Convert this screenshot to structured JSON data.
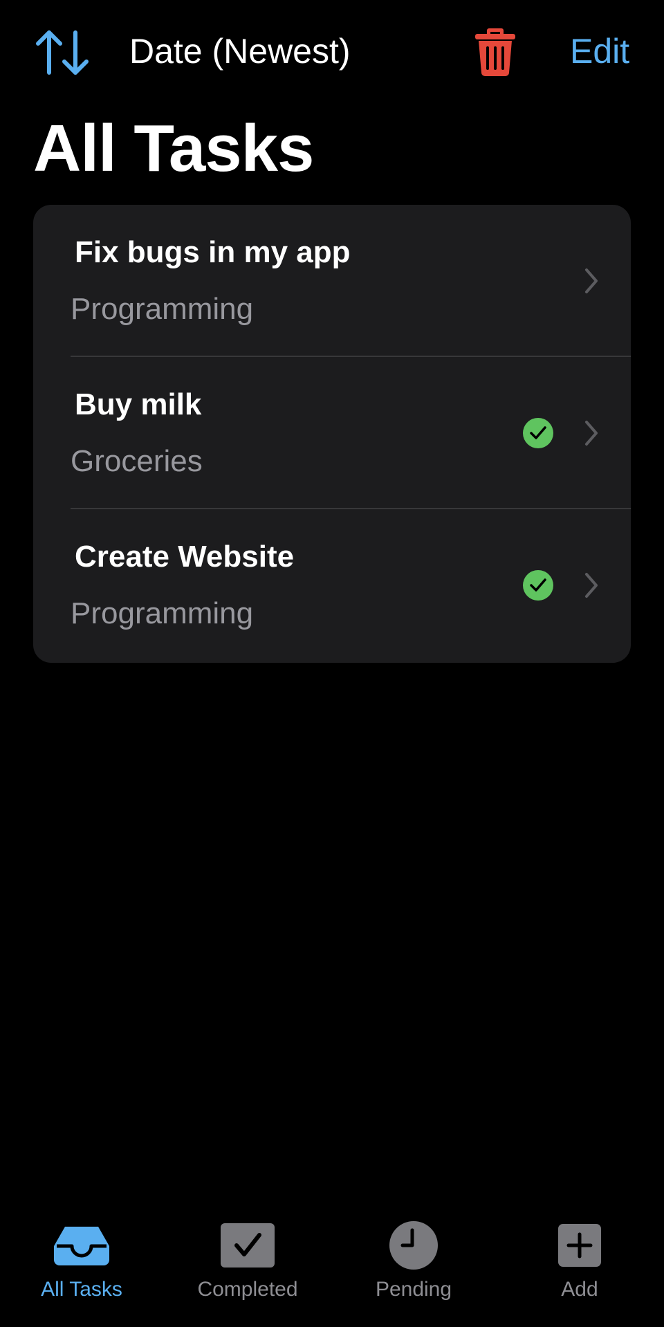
{
  "toolbar": {
    "sort_icon": "arrow-up-down-icon",
    "sort_label": "Date (Newest)",
    "trash_icon": "trash-icon",
    "edit_label": "Edit"
  },
  "page": {
    "title": "All Tasks"
  },
  "tasks": [
    {
      "title": "Fix bugs in my app",
      "category": "Programming",
      "completed": false
    },
    {
      "title": "Buy milk",
      "category": "Groceries",
      "completed": true
    },
    {
      "title": "Create Website",
      "category": "Programming",
      "completed": true
    }
  ],
  "tab_bar": {
    "tabs": [
      {
        "label": "All Tasks",
        "icon": "tray-icon",
        "active": true
      },
      {
        "label": "Completed",
        "icon": "checkmark-square-icon",
        "active": false
      },
      {
        "label": "Pending",
        "icon": "clock-icon",
        "active": false
      },
      {
        "label": "Add",
        "icon": "plus-square-icon",
        "active": false
      }
    ]
  },
  "colors": {
    "background": "#000000",
    "card": "#1c1c1e",
    "accent": "#5aaff0",
    "destructive": "#e5483a",
    "success": "#5fc45f",
    "secondary_text": "#98989e",
    "inactive_tab": "#8e8e93"
  }
}
